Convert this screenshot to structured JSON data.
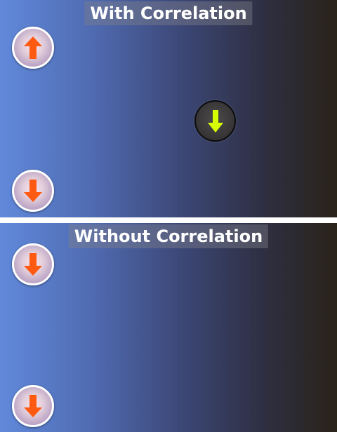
{
  "panels": [
    {
      "title": "With Correlation",
      "buttons": [
        {
          "name": "up-button",
          "icon": "arrow-up-icon",
          "color": "#ff5a12"
        },
        {
          "name": "down-button",
          "icon": "arrow-down-icon",
          "color": "#ff5a12"
        },
        {
          "name": "down-button-dark",
          "icon": "arrow-down-icon",
          "color": "#d7ff00"
        }
      ]
    },
    {
      "title": "Without Correlation",
      "buttons": [
        {
          "name": "down-button",
          "icon": "arrow-down-icon",
          "color": "#ff5a12"
        },
        {
          "name": "down-button",
          "icon": "arrow-down-icon",
          "color": "#ff5a12"
        }
      ]
    }
  ],
  "colors": {
    "gradient_left": "#6189db",
    "gradient_right": "#2a2318",
    "arrow_orange": "#ff5a12",
    "arrow_lime": "#d7ff00"
  }
}
